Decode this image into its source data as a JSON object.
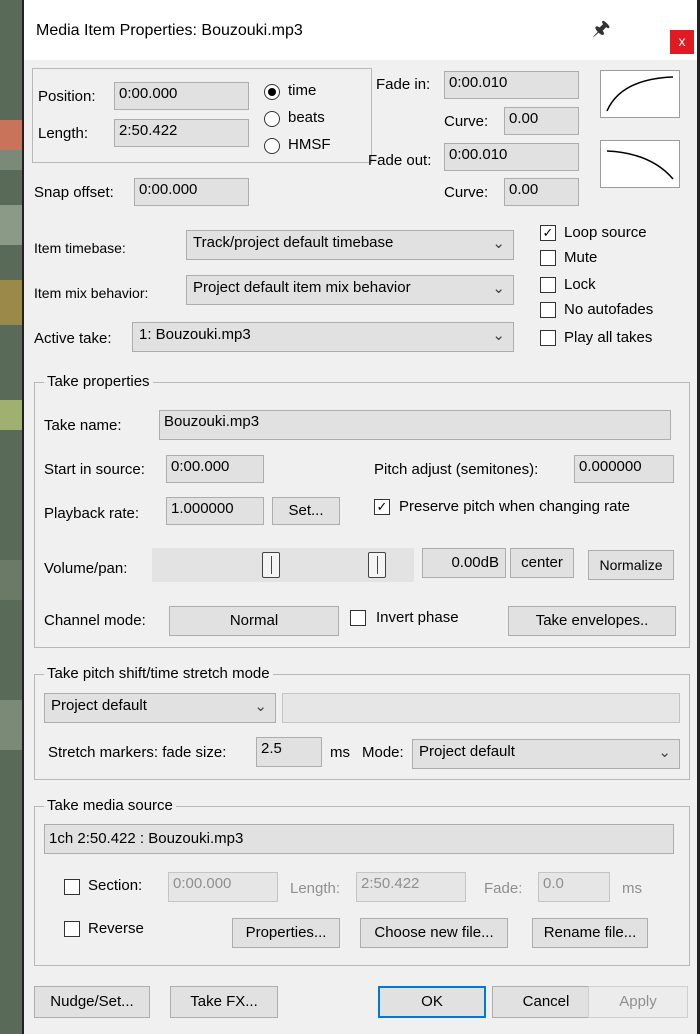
{
  "window": {
    "title": "Media Item Properties:  Bouzouki.mp3",
    "close_label": "x",
    "pin_icon": "pin-icon"
  },
  "timing": {
    "position_label": "Position:",
    "position_value": "0:00.000",
    "length_label": "Length:",
    "length_value": "2:50.422",
    "radio_time": "time",
    "radio_beats": "beats",
    "radio_hmsf": "HMSF",
    "fade_in_label": "Fade in:",
    "fade_in_value": "0:00.010",
    "curve_label": "Curve:",
    "fade_in_curve": "0.00",
    "fade_out_label": "Fade out:",
    "fade_out_value": "0:00.010",
    "fade_out_curve": "0.00",
    "snap_offset_label": "Snap offset:",
    "snap_offset_value": "0:00.000"
  },
  "item": {
    "timebase_label": "Item timebase:",
    "timebase_value": "Track/project default timebase",
    "mix_label": "Item mix behavior:",
    "mix_value": "Project default item mix behavior",
    "active_take_label": "Active take:",
    "active_take_value": "1: Bouzouki.mp3",
    "loop_source": "Loop source",
    "mute": "Mute",
    "lock": "Lock",
    "no_autofades": "No autofades",
    "play_all_takes": "Play all takes"
  },
  "take": {
    "group_title": "Take properties",
    "name_label": "Take name:",
    "name_value": "Bouzouki.mp3",
    "start_label": "Start in source:",
    "start_value": "0:00.000",
    "pitch_label": "Pitch adjust (semitones):",
    "pitch_value": "0.000000",
    "rate_label": "Playback rate:",
    "rate_value": "1.000000",
    "set_button": "Set...",
    "preserve_pitch": "Preserve pitch when changing rate",
    "volpan_label": "Volume/pan:",
    "db_value": "0.00dB",
    "center_button": "center",
    "normalize_button": "Normalize",
    "channel_label": "Channel mode:",
    "channel_value": "Normal",
    "invert_phase": "Invert phase",
    "envelopes_button": "Take envelopes.."
  },
  "stretch": {
    "group_title": "Take pitch shift/time stretch mode",
    "mode_value": "Project default",
    "markers_label": "Stretch markers: fade size:",
    "fade_size": "2.5",
    "ms_label": "ms",
    "mode_label": "Mode:",
    "mode2_value": "Project default"
  },
  "source": {
    "group_title": "Take media source",
    "info": "1ch 2:50.422 : Bouzouki.mp3",
    "section_label": "Section:",
    "section_value": "0:00.000",
    "length_label": "Length:",
    "length_value": "2:50.422",
    "fade_label": "Fade:",
    "fade_value": "0.0",
    "ms_label": "ms",
    "reverse_label": "Reverse",
    "properties_button": "Properties...",
    "choose_button": "Choose new file...",
    "rename_button": "Rename file..."
  },
  "footer": {
    "nudge": "Nudge/Set...",
    "take_fx": "Take FX...",
    "ok": "OK",
    "cancel": "Cancel",
    "apply": "Apply"
  }
}
